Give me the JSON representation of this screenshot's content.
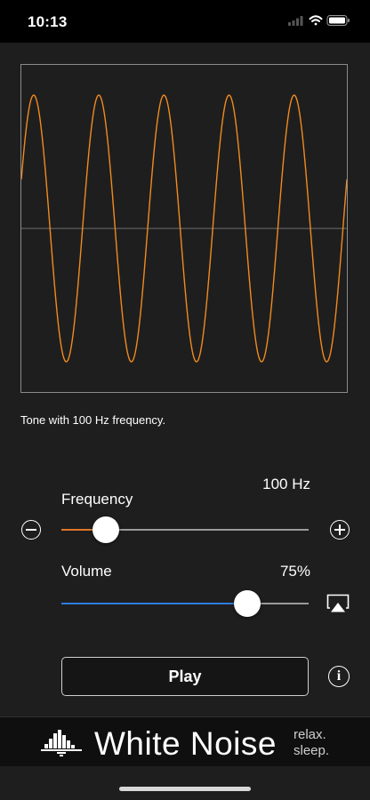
{
  "status_bar": {
    "time": "10:13"
  },
  "waveform": {
    "frequency_hz": 100,
    "cycles_shown": 5,
    "wave_color": "#f28a1e",
    "axis_color": "#6e6e6e"
  },
  "caption": "Tone with 100 Hz frequency.",
  "frequency": {
    "label": "Frequency",
    "value_text": "100 Hz",
    "slider_fraction": 0.18,
    "fill_color": "#e0782a"
  },
  "volume": {
    "label": "Volume",
    "value_text": "75%",
    "slider_fraction": 0.75,
    "fill_color": "#2f7de0"
  },
  "play_button": {
    "label": "Play"
  },
  "info_button": {
    "glyph": "i"
  },
  "banner": {
    "brand": "White Noise",
    "tagline_1": "relax.",
    "tagline_2": "sleep."
  },
  "icons": [
    "minus-circle-icon",
    "plus-circle-icon",
    "airplay-icon",
    "info-icon",
    "signal-icon",
    "wifi-icon",
    "battery-icon",
    "white-noise-logo-icon"
  ]
}
